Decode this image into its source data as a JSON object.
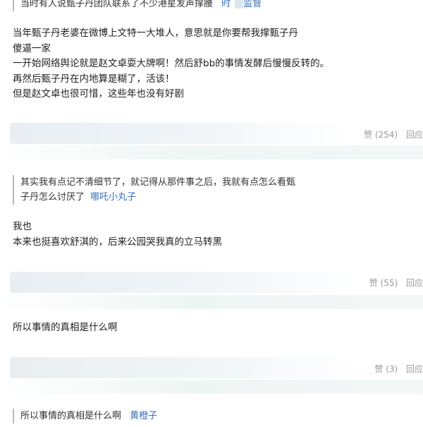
{
  "top_quote": {
    "text": "当时有人说甄子丹团队联系了不少港星发声撑腰",
    "user_prefix": "时",
    "user_suffix": "监督"
  },
  "comment1": {
    "lines": [
      "当年甄子丹老婆在微博上文特一大堆人，意思就是你要帮我撑甄子丹",
      "傻逼一家",
      "一开始网络舆论就是赵文卓耍大牌啊！然后舒bb的事情发酵后慢慢反转的。",
      "再然后甄子丹在内地算是糊了，活该！",
      "但是赵文卓也很可惜，这些年也没有好剧"
    ],
    "like_label": "赞 (254)",
    "reply_label": "回应"
  },
  "quote2": {
    "line1": "其实我有点记不清细节了，就记得从那件事之后，我就有点怎么看甄",
    "line2": "子丹怎么讨厌了",
    "user": "哪吒小丸子"
  },
  "comment2": {
    "lines": [
      "我也",
      "本来也挺喜欢舒淇的，后来公园哭我真的立马转黑"
    ],
    "like_label": "赞 (55)",
    "reply_label": "回应"
  },
  "comment3": {
    "lines": [
      "所以事情的真相是什么啊"
    ],
    "like_label": "赞 (3)",
    "reply_label": "回应"
  },
  "quote3": {
    "text": "所以事情的真相是什么啊",
    "user": "黄橙子"
  }
}
